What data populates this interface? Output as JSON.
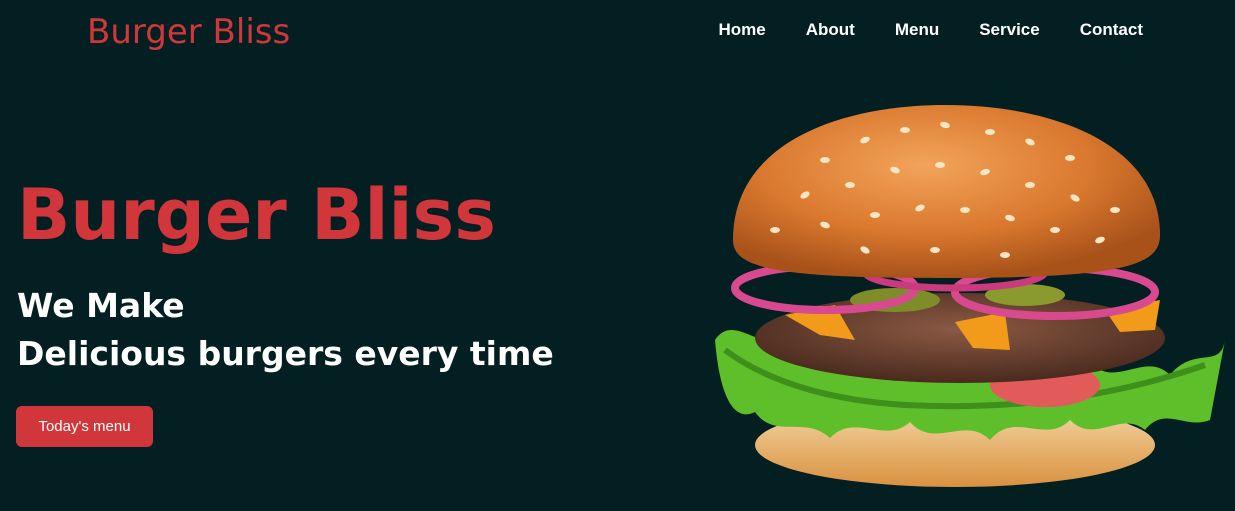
{
  "brand": {
    "name": "Burger Bliss"
  },
  "nav": {
    "items": [
      {
        "label": "Home"
      },
      {
        "label": "About"
      },
      {
        "label": "Menu"
      },
      {
        "label": "Service"
      },
      {
        "label": "Contact"
      }
    ]
  },
  "hero": {
    "title": "Burger Bliss",
    "subtitle_line1": "We Make",
    "subtitle_line2": "Delicious burgers every time",
    "cta_label": "Today's menu"
  },
  "colors": {
    "background": "#031f22",
    "accent": "#d1363a",
    "text": "#ffffff"
  },
  "image": {
    "icon": "burger-photo"
  }
}
